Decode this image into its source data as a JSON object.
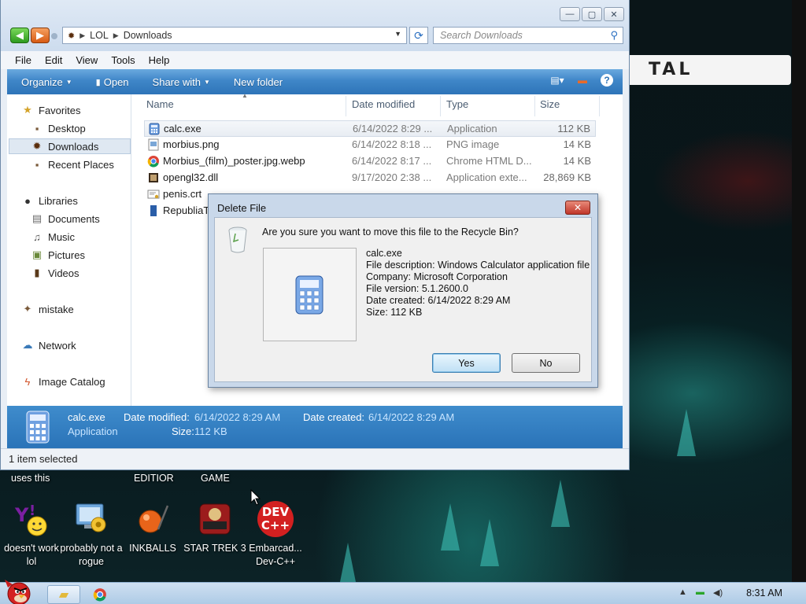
{
  "window": {
    "caption_minimize": "—",
    "caption_maximize": "▢",
    "caption_close": "✕",
    "breadcrumb": [
      "LOL",
      "Downloads"
    ],
    "search_placeholder": "Search Downloads"
  },
  "menu": [
    "File",
    "Edit",
    "View",
    "Tools",
    "Help"
  ],
  "toolbar": {
    "organize": "Organize",
    "open": "Open",
    "share_with": "Share with",
    "new_folder": "New folder"
  },
  "nav": {
    "favorites": "Favorites",
    "desktop": "Desktop",
    "downloads": "Downloads",
    "recent_places": "Recent Places",
    "libraries": "Libraries",
    "documents": "Documents",
    "music": "Music",
    "pictures": "Pictures",
    "videos": "Videos",
    "mistake": "mistake",
    "network": "Network",
    "image_catalog": "Image Catalog"
  },
  "columns": {
    "name": "Name",
    "date": "Date modified",
    "type": "Type",
    "size": "Size"
  },
  "files": [
    {
      "name": "calc.exe",
      "date": "6/14/2022 8:29 ...",
      "type": "Application",
      "size": "112 KB",
      "icon": "calculator-icon"
    },
    {
      "name": "morbius.png",
      "date": "6/14/2022 8:18 ...",
      "type": "PNG image",
      "size": "14 KB",
      "icon": "image-file-icon"
    },
    {
      "name": "Morbius_(film)_poster.jpg.webp",
      "date": "6/14/2022 8:17 ...",
      "type": "Chrome HTML D...",
      "size": "14 KB",
      "icon": "chrome-icon"
    },
    {
      "name": "opengl32.dll",
      "date": "9/17/2020 2:38 ...",
      "type": "Application exte...",
      "size": "28,869 KB",
      "icon": "dll-file-icon"
    },
    {
      "name": "penis.crt",
      "date": "",
      "type": "",
      "size": "",
      "icon": "certificate-icon"
    },
    {
      "name": "RepubliaT",
      "date": "",
      "type": "",
      "size": "",
      "icon": "document-icon"
    }
  ],
  "details": {
    "name": "calc.exe",
    "type": "Application",
    "modified_label": "Date modified:",
    "modified_value": "6/14/2022 8:29 AM",
    "created_label": "Date created:",
    "created_value": "6/14/2022 8:29 AM",
    "size_label": "Size:",
    "size_value": "112 KB"
  },
  "status": "1 item selected",
  "dialog": {
    "title": "Delete File",
    "close": "✕",
    "question": "Are you sure you want to move this file to the Recycle Bin?",
    "info": [
      "calc.exe",
      "File description: Windows Calculator application file",
      "Company: Microsoft Corporation",
      "File version: 5.1.2600.0",
      "Date created: 6/14/2022 8:29 AM",
      "Size: 112 KB"
    ],
    "yes": "Yes",
    "no": "No"
  },
  "desktop": {
    "top_labels": [
      "uses this",
      "EDITIOR",
      "GAME"
    ],
    "banner": "TAL",
    "icons": [
      {
        "label": "doesn't work lol",
        "icon": "yahoo-messenger-icon"
      },
      {
        "label": "probably not a rogue",
        "icon": "system-utility-icon"
      },
      {
        "label": "INKBALLS",
        "icon": "inkball-icon"
      },
      {
        "label": "STAR TREK 3",
        "icon": "star-wars-game-icon"
      },
      {
        "label": "Embarcad... Dev-C++",
        "icon": "dev-cpp-icon"
      }
    ],
    "dev_badge": [
      "DEV",
      "C++"
    ]
  },
  "taskbar": {
    "clock": "8:31 AM"
  },
  "colors": {
    "toolbar": "#3f86c8",
    "details": "#2a73b8",
    "dialog_frame": "#c9d8ea"
  }
}
